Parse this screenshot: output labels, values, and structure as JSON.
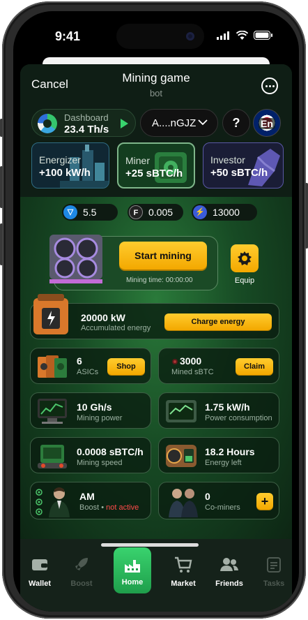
{
  "status": {
    "time": "9:41"
  },
  "header": {
    "cancel": "Cancel",
    "title": "Mining game",
    "subtitle": "bot"
  },
  "topbar": {
    "dashboard_label": "Dashboard",
    "dashboard_value": "23.4 Th/s",
    "wallet_address": "A....nGJZ",
    "help": "?",
    "language": "En"
  },
  "cards": [
    {
      "title": "Energizer",
      "value": "+100 kW/h"
    },
    {
      "title": "Miner",
      "value": "+25 sBTC/h"
    },
    {
      "title": "Investor",
      "value": "+50 sBTC/h"
    }
  ],
  "balances": [
    {
      "icon": "ton-coin-icon",
      "value": "5.5"
    },
    {
      "icon": "f-coin-icon",
      "value": "0.005"
    },
    {
      "icon": "bolt-coin-icon",
      "value": "13000"
    }
  ],
  "mining": {
    "start_label": "Start mining",
    "time_label": "Mining time:",
    "time_value": "00:00:00",
    "equip_label": "Equip"
  },
  "energy": {
    "value": "20000 kW",
    "label": "Accumulated energy",
    "button": "Charge energy"
  },
  "asics": {
    "value": "6",
    "label": "ASICs",
    "button": "Shop"
  },
  "mined": {
    "value": "3000",
    "label": "Mined sBTC",
    "button": "Claim"
  },
  "power": {
    "value": "10 Gh/s",
    "label": "Mining power"
  },
  "consumption": {
    "value": "1.75 kW/h",
    "label": "Power consumption"
  },
  "speed": {
    "value": "0.0008 sBTC/h",
    "label": "Mining speed"
  },
  "energy_left": {
    "value": "18.2 Hours",
    "label": "Energy left"
  },
  "boost": {
    "value": "AM",
    "label": "Boost",
    "separator": "•",
    "status": "not active"
  },
  "coop": {
    "value": "0",
    "label": "Co-miners",
    "button": "+"
  },
  "nav": [
    {
      "label": "Wallet",
      "active": false
    },
    {
      "label": "Boost",
      "active": false
    },
    {
      "label": "Home",
      "active": true
    },
    {
      "label": "Market",
      "active": false
    },
    {
      "label": "Friends",
      "active": false
    },
    {
      "label": "Tasks",
      "active": false
    }
  ],
  "colors": {
    "accent_yellow": "#f7b500",
    "accent_green": "#39d36e",
    "warning_red": "#ff4a4a",
    "bg_dark": "#0d1a12"
  }
}
